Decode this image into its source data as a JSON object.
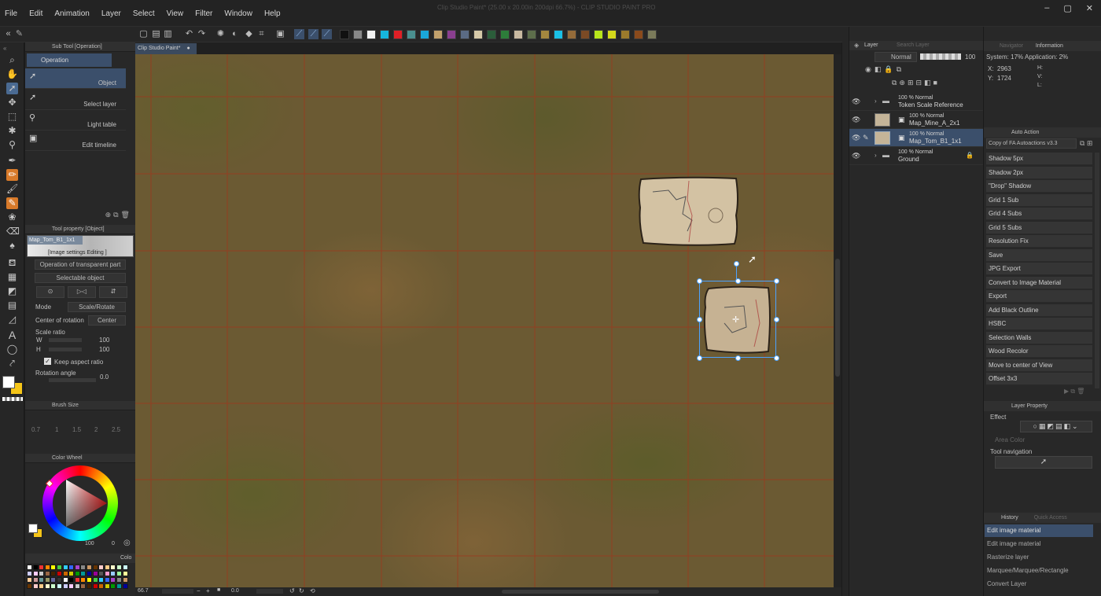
{
  "app": {
    "title": "Clip Studio Paint* (25.00 x 20.00in 200dpi 66.7%) - CLIP STUDIO PAINT PRO",
    "menu": [
      "File",
      "Edit",
      "Animation",
      "Layer",
      "Select",
      "View",
      "Filter",
      "Window",
      "Help"
    ],
    "window_controls": [
      "–",
      "▢",
      "✕"
    ]
  },
  "toolbar": {
    "palette": [
      "#111111",
      "#888888",
      "#f2f2f2",
      "#16b6dd",
      "#e01f26",
      "#4a8f8f",
      "#1aa7d9",
      "#c2a16c",
      "#8a3f8f",
      "#5b6b84",
      "#d6c9a8",
      "#2b5d3a",
      "#2d7d3a",
      "#c9b9a1",
      "#5d6d4b",
      "#a4873f",
      "#1ac0e6",
      "#946b3a",
      "#7b4a25",
      "#b8e51b",
      "#d4d91b",
      "#9c7a2c",
      "#8a4a1c",
      "#7a7a5a"
    ]
  },
  "tools": {
    "icons": [
      "magnifier-icon",
      "hand-icon",
      "operation-icon",
      "move-icon",
      "marquee-icon",
      "auto-select-icon",
      "eyedropper-icon",
      "pen-icon",
      "pencil-icon",
      "brush-icon",
      "airbrush-icon",
      "eraser-icon",
      "fill-icon",
      "gradient-icon",
      "figure-icon",
      "frame-icon",
      "ruler-icon",
      "text-icon",
      "balloon-icon",
      "correct-line-icon"
    ]
  },
  "subtool": {
    "title": "Sub Tool [Operation]",
    "group_tab": "Operation",
    "items": [
      {
        "label": "Object",
        "icon": "object-icon",
        "selected": true
      },
      {
        "label": "Select layer",
        "icon": "select-layer-icon"
      },
      {
        "label": "Light table",
        "icon": "light-table-icon"
      },
      {
        "label": "Edit timeline",
        "icon": "edit-timeline-icon"
      }
    ]
  },
  "toolprop": {
    "title": "Tool property [Object]",
    "material_name": "Map_Tom_B1_1x1",
    "image_settings": "[Image settings Editing ]",
    "transparent_op": "Operation of transparent part",
    "selectable": "Selectable object",
    "mode_label": "Mode",
    "mode_value": "Scale/Rotate",
    "center_label": "Center of rotation",
    "center_value": "Center",
    "scale_label": "Scale ratio",
    "w_label": "W",
    "w_value": "100",
    "h_label": "H",
    "h_value": "100",
    "keep_aspect": "Keep aspect ratio",
    "rotation_label": "Rotation angle",
    "rotation_value": "0.0"
  },
  "brushsize": {
    "title": "Brush Size",
    "values": [
      "0.7",
      "1",
      "1.5",
      "2",
      "2.5"
    ]
  },
  "colorwheel": {
    "title": "Color Wheel",
    "readout": "100",
    "readout2": "0",
    "main_color": "#ffffff",
    "sub_color": "#f5c518"
  },
  "colorset": {
    "title": "Colo"
  },
  "document": {
    "tab_label": "Clip Studio Paint*",
    "zoom": "66.7",
    "angle": "0.0"
  },
  "layers": {
    "title": "Layer",
    "search": "Search Layer",
    "blend_mode": "Normal",
    "opacity": "100",
    "rows": [
      {
        "line1": "100 % Normal",
        "line2": "Token Scale Reference",
        "type": "folder"
      },
      {
        "line1": "100 % Normal",
        "line2": "Map_Mine_A_2x1",
        "type": "image"
      },
      {
        "line1": "100 % Normal",
        "line2": "Map_Tom_B1_1x1",
        "type": "image",
        "selected": true
      },
      {
        "line1": "100 % Normal",
        "line2": "Ground",
        "type": "folder",
        "locked": true
      }
    ]
  },
  "navigator": {
    "tab1": "Navigator",
    "tab2": "Information",
    "system": "System: 17%",
    "application": "Application: 2%",
    "x": "2963",
    "y": "1724",
    "h_label": "H:",
    "v_label": "V:",
    "l_label": "L:"
  },
  "autoaction": {
    "title": "Auto Action",
    "set_name": "Copy of FA Autoactions v3.3",
    "items": [
      "Shadow 5px",
      "Shadow 2px",
      "\"Drop\" Shadow",
      "Grid 1 Sub",
      "Grid 4 Subs",
      "Grid 5 Subs",
      "Resolution Fix",
      "Save",
      "JPG Export",
      "Convert to Image Material",
      "Export",
      "Add Black Outline",
      "HSBC",
      "Selection Walls",
      "Wood Recolor",
      "Move to center of View",
      "Offset 3x3"
    ]
  },
  "layerprop": {
    "title": "Layer Property",
    "effect": "Effect",
    "area_color": "Area Color",
    "tool_nav": "Tool navigation"
  },
  "history": {
    "tab1": "History",
    "tab2": "Quick Access",
    "items": [
      "Edit image material",
      "Edit image material",
      "Rasterize layer",
      "Marquee/Marquee/Rectangle",
      "Convert Layer"
    ]
  }
}
